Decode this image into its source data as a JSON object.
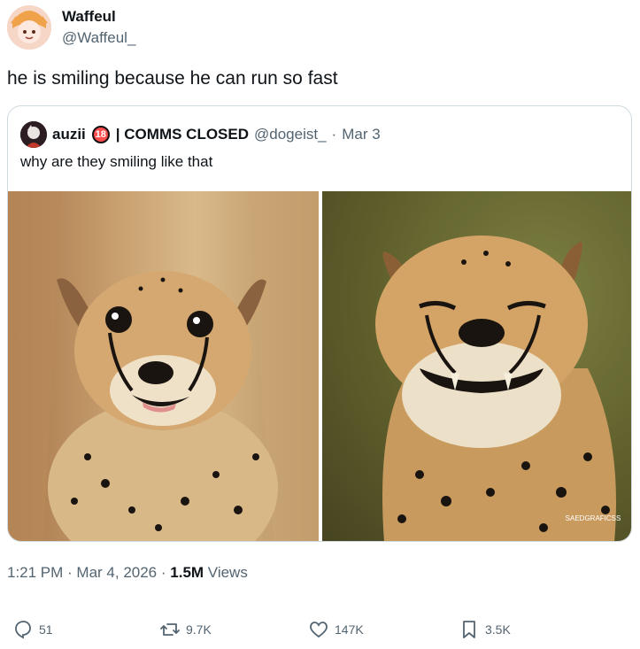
{
  "tweet": {
    "author_name": "Waffeul",
    "author_handle": "@Waffeul_",
    "text": "he is smiling because he can run so fast",
    "timestamp": "1:21 PM · Mar 4, 2026",
    "views_count": "1.5M",
    "views_label": "Views"
  },
  "quote": {
    "author_name": "auzii",
    "age_badge": "18",
    "author_suffix": "| COMMS CLOSED",
    "handle": "@dogeist_",
    "date": "Mar 3",
    "text": "why are they smiling like that",
    "watermark": "SAEDGRAFICSS"
  },
  "actions": {
    "replies": "51",
    "reposts": "9.7K",
    "likes": "147K",
    "bookmarks": "3.5K"
  },
  "colors": {
    "text": "#0f1419",
    "muted": "#536471",
    "border": "#cfd9de"
  }
}
